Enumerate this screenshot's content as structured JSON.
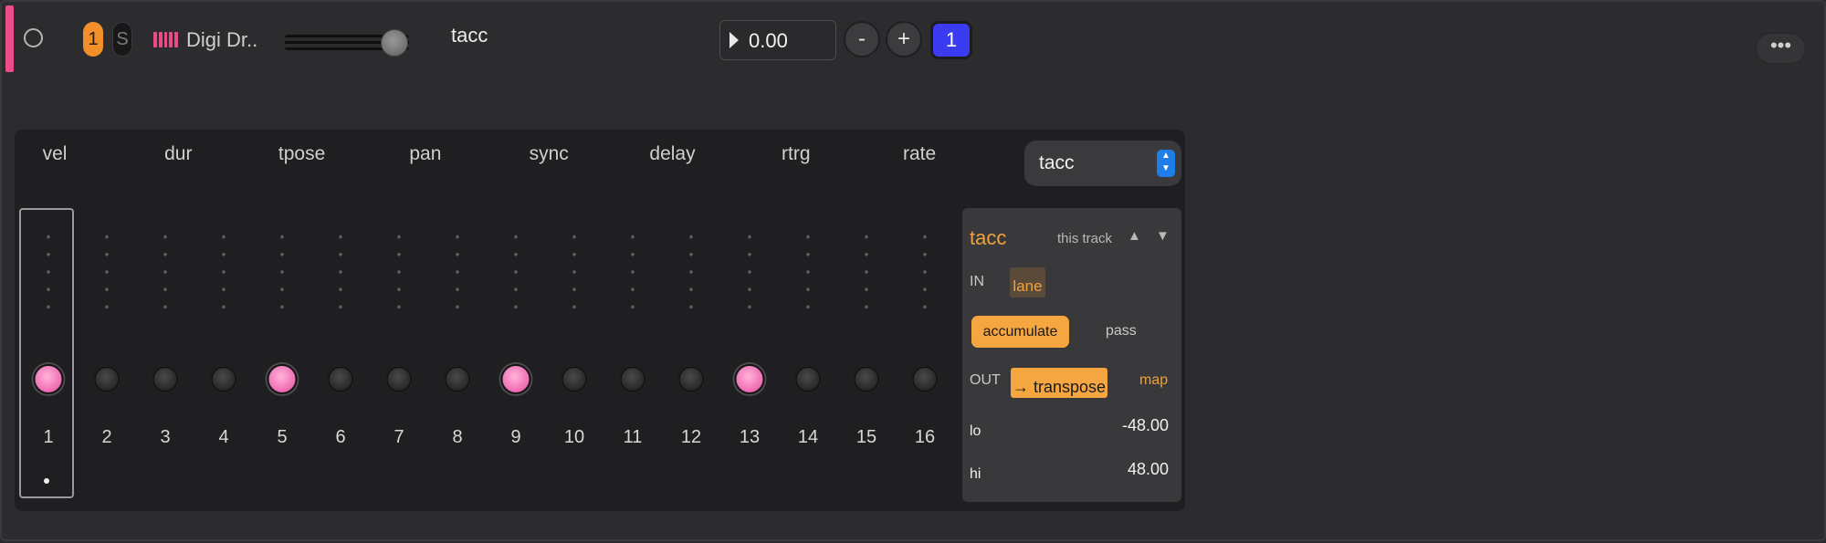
{
  "track": {
    "number": "1",
    "solo_label": "S",
    "instrument_icon": "piano-keys-icon",
    "instrument_name": "Digi Dr..",
    "device_title": "tacc",
    "tempo_value": "0.00",
    "minus_label": "-",
    "plus_label": "+",
    "count_label": "1",
    "more_label": "•••",
    "accent_color": "#ec4c8a"
  },
  "lanes": [
    "vel",
    "dur",
    "tpose",
    "pan",
    "sync",
    "delay",
    "rtrg",
    "rate"
  ],
  "steps": [
    {
      "num": "1",
      "on": true
    },
    {
      "num": "2",
      "on": false
    },
    {
      "num": "3",
      "on": false
    },
    {
      "num": "4",
      "on": false
    },
    {
      "num": "5",
      "on": true
    },
    {
      "num": "6",
      "on": false
    },
    {
      "num": "7",
      "on": false
    },
    {
      "num": "8",
      "on": false
    },
    {
      "num": "9",
      "on": true
    },
    {
      "num": "10",
      "on": false
    },
    {
      "num": "11",
      "on": false
    },
    {
      "num": "12",
      "on": false
    },
    {
      "num": "13",
      "on": true
    },
    {
      "num": "14",
      "on": false
    },
    {
      "num": "15",
      "on": false
    },
    {
      "num": "16",
      "on": false
    }
  ],
  "selected_step": "1",
  "preset": {
    "label": "tacc"
  },
  "side": {
    "title": "tacc",
    "scope": "this track",
    "up": "▲",
    "down": "▼",
    "in_label": "IN",
    "in_value": "lane",
    "mode_active": "accumulate",
    "mode_other": "pass",
    "out_label": "OUT",
    "out_value": "→ transpose",
    "map_label": "map",
    "lo_label": "lo",
    "lo_value": "-48.00",
    "hi_label": "hi",
    "hi_value": "48.00",
    "accent_color": "#f0a13a"
  }
}
